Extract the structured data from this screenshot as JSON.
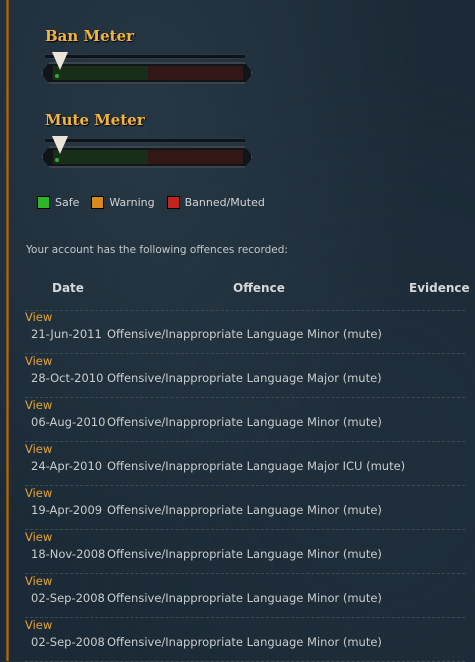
{
  "meters": {
    "ban_title": "Ban Meter",
    "mute_title": "Mute Meter"
  },
  "legend": [
    {
      "label": "Safe",
      "color": "#2fb52a"
    },
    {
      "label": "Warning",
      "color": "#d68a1e"
    },
    {
      "label": "Banned/Muted",
      "color": "#c2241f"
    }
  ],
  "intro_text": "Your account has the following offences recorded:",
  "table": {
    "headers": {
      "date": "Date",
      "offence": "Offence",
      "evidence": "Evidence"
    },
    "rows": [
      {
        "date": "21-Jun-2011",
        "offence": "Offensive/Inappropriate Language Minor (mute)",
        "evidence": "View"
      },
      {
        "date": "28-Oct-2010",
        "offence": "Offensive/Inappropriate Language Major (mute)",
        "evidence": "View"
      },
      {
        "date": "06-Aug-2010",
        "offence": "Offensive/Inappropriate Language Minor (mute)",
        "evidence": "View"
      },
      {
        "date": "24-Apr-2010",
        "offence": "Offensive/Inappropriate Language Major ICU (mute)",
        "evidence": "View"
      },
      {
        "date": "19-Apr-2009",
        "offence": "Offensive/Inappropriate Language Minor (mute)",
        "evidence": "View"
      },
      {
        "date": "18-Nov-2008",
        "offence": "Offensive/Inappropriate Language Minor (mute)",
        "evidence": "View"
      },
      {
        "date": "02-Sep-2008",
        "offence": "Offensive/Inappropriate Language Minor (mute)",
        "evidence": "View"
      },
      {
        "date": "02-Sep-2008",
        "offence": "Offensive/Inappropriate Language Minor (mute)",
        "evidence": "View"
      }
    ]
  }
}
